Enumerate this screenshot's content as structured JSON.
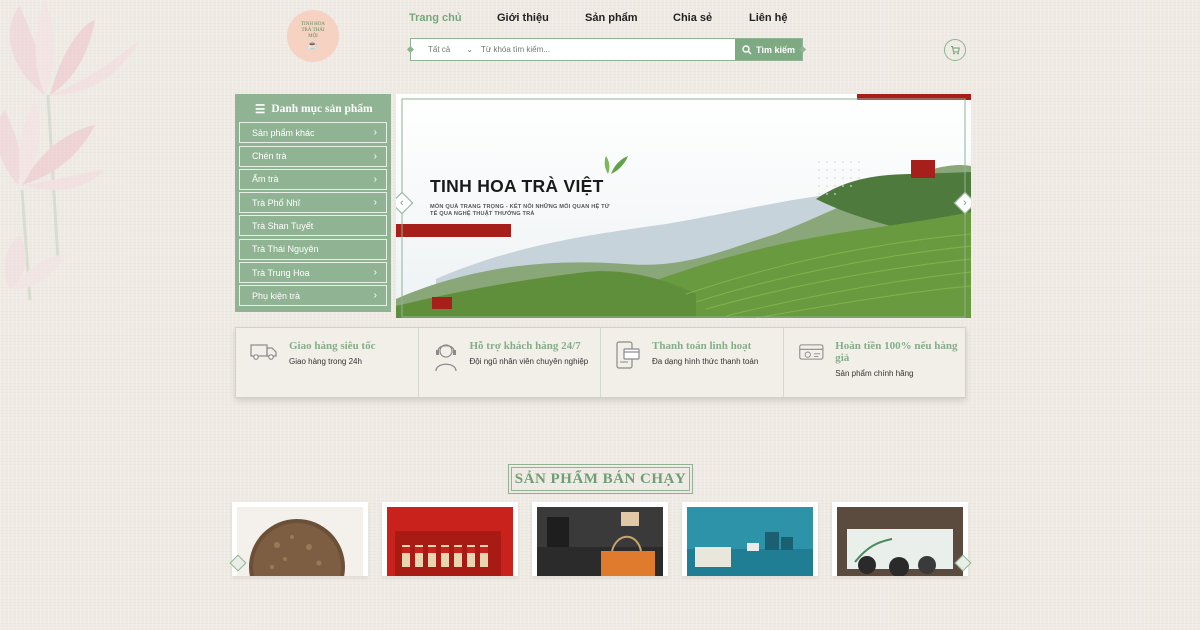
{
  "header": {
    "logo_text": "TINH HOA TRÀ THÁI MỘI",
    "nav": [
      {
        "label": "Trang chủ",
        "active": true
      },
      {
        "label": "Giới thiệu",
        "active": false
      },
      {
        "label": "Sản phẩm",
        "active": false
      },
      {
        "label": "Chia sẻ",
        "active": false
      },
      {
        "label": "Liên hệ",
        "active": false
      }
    ],
    "search": {
      "category": "Tất cả",
      "placeholder": "Từ khóa tìm kiếm...",
      "button": "Tìm kiếm"
    }
  },
  "sidebar": {
    "title": "Danh mục sản phẩm",
    "items": [
      {
        "label": "Sản phẩm khác",
        "has_children": true
      },
      {
        "label": "Chén trà",
        "has_children": true
      },
      {
        "label": "Ấm trà",
        "has_children": true
      },
      {
        "label": "Trà Phổ Nhĩ",
        "has_children": true
      },
      {
        "label": "Trà Shan Tuyết",
        "has_children": false
      },
      {
        "label": "Trà Thái Nguyên",
        "has_children": false
      },
      {
        "label": "Trà Trung Hoa",
        "has_children": true
      },
      {
        "label": "Phụ kiện trà",
        "has_children": true
      }
    ]
  },
  "banner": {
    "title": "TINH HOA TRÀ VIỆT",
    "subtitle": "MÓN QUÀ TRANG TRỌNG - KẾT NỐI NHỮNG MỐI QUAN HỆ TỬ TẾ QUA NGHỆ THUẬT THƯỞNG TRÀ"
  },
  "features": [
    {
      "icon": "delivery-truck-icon",
      "title": "Giao hàng siêu tốc",
      "desc": "Giao hàng trong 24h"
    },
    {
      "icon": "support-agent-icon",
      "title": "Hỗ trợ khách hàng 24/7",
      "desc": "Đội ngũ nhân viên chuyên nghiệp"
    },
    {
      "icon": "payment-icon",
      "title": "Thanh toán linh hoạt",
      "desc": "Đa dạng hình thức thanh toán"
    },
    {
      "icon": "refund-card-icon",
      "title": "Hoàn tiền 100% nếu hàng giả",
      "desc": "Sản phẩm chính hãng"
    }
  ],
  "bestsellers": {
    "title": "SẢN PHẨM BÁN CHẠY"
  },
  "colors": {
    "accent": "#8fb393",
    "accent_text": "#78a67d",
    "banner_red": "#a61f1b",
    "background": "#efebe4"
  }
}
